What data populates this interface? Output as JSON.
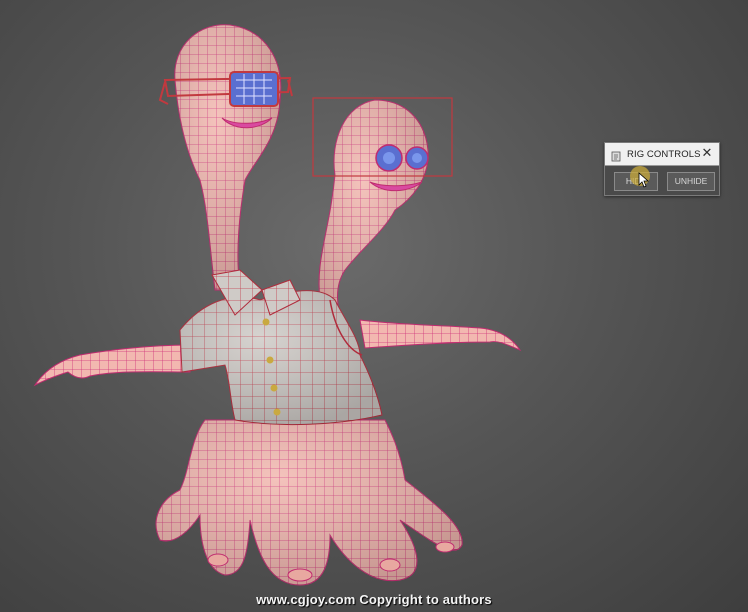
{
  "rig_panel": {
    "title": "RIG CONTROLS",
    "close_icon": "close-icon",
    "title_icon": "script-icon",
    "buttons": {
      "hide_label": "HIDE",
      "unhide_label": "UNHIDE"
    }
  },
  "watermark": "www.cgjoy.com Copyright to authors",
  "colors": {
    "skin": "#f2b8b0",
    "wire": "#d0327a",
    "shirt": "#c9c4c0",
    "selection": "#c2393f",
    "eye": "#5a6fd0"
  }
}
